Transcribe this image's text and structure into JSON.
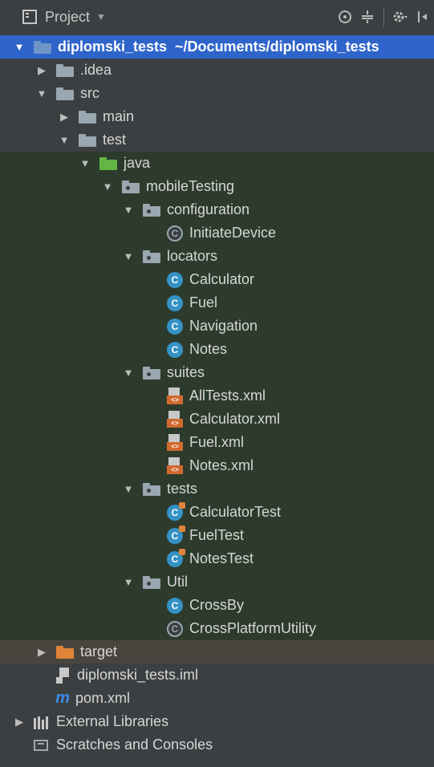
{
  "panel": {
    "title": "Project"
  },
  "tree": {
    "project": {
      "name": "diplomski_tests",
      "path": "~/Documents/diplomski_tests"
    },
    "idea": ".idea",
    "src": "src",
    "main": "main",
    "test": "test",
    "java": "java",
    "mobileTesting": "mobileTesting",
    "configuration": "configuration",
    "initiateDevice": "InitiateDevice",
    "locators": "locators",
    "calculator": "Calculator",
    "fuel": "Fuel",
    "navigation": "Navigation",
    "notes": "Notes",
    "suites": "suites",
    "allTestsXml": "AllTests.xml",
    "calculatorXml": "Calculator.xml",
    "fuelXml": "Fuel.xml",
    "notesXml": "Notes.xml",
    "tests": "tests",
    "calculatorTest": "CalculatorTest",
    "fuelTest": "FuelTest",
    "notesTest": "NotesTest",
    "util": "Util",
    "crossBy": "CrossBy",
    "crossPlatformUtility": "CrossPlatformUtility",
    "target": "target",
    "iml": "diplomski_tests.iml",
    "pom": "pom.xml",
    "externalLibraries": "External Libraries",
    "scratches": "Scratches and Consoles"
  },
  "colors": {
    "selection": "#2f65ca",
    "sourcesRow": "#2d3b2d",
    "targetRow": "#49453e",
    "background": "#3c3f41"
  }
}
